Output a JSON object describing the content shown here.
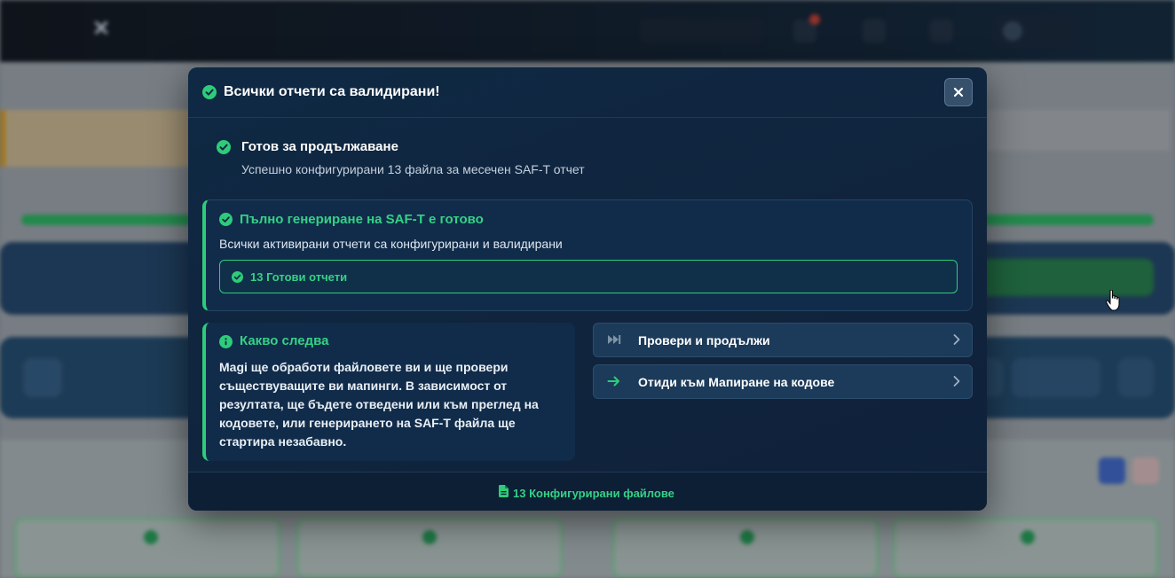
{
  "modal": {
    "title": "Всички отчети са валидирани!",
    "close_label": "✕",
    "ready": {
      "title": "Готов за продължаване",
      "subtitle": "Успешно конфигурирани 13 файла за месечен SAF-T отчет"
    },
    "generation": {
      "title": "Пълно генериране на SAF-T е готово",
      "description": "Всички активирани отчети са конфигурирани и валидирани",
      "ready_badge": "13 Готови отчети"
    },
    "next": {
      "title": "Какво следва",
      "body": "Magi ще обработи файловете ви и ще провери съществуващите ви мапинги. В зависимост от резултата, ще бъдете отведени или към преглед на кодовете, или генерирането на SAF-T файла ще стартира незабавно."
    },
    "actions": [
      {
        "label": "Провери и продължи",
        "icon": "skip-forward-icon"
      },
      {
        "label": "Отиди към Мапиране на кодове",
        "icon": "arrow-right-icon"
      }
    ],
    "footer": {
      "label": "13 Конфигурирани файлове",
      "icon": "file-icon"
    }
  },
  "colors": {
    "accent_green": "#2ecc7a",
    "modal_bg": "#10243d",
    "text_white": "#ffffff"
  }
}
